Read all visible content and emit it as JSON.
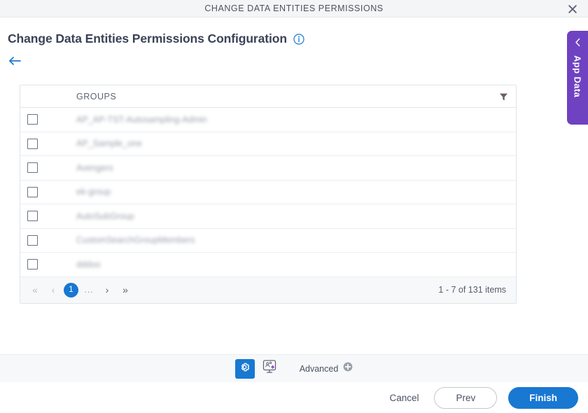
{
  "window": {
    "title": "CHANGE DATA ENTITIES PERMISSIONS",
    "close_icon": "close-icon"
  },
  "page": {
    "title": "Change Data Entities Permissions Configuration",
    "info_icon": "info-icon",
    "back_icon": "back-arrow-icon"
  },
  "grid": {
    "columns": [
      "",
      "GROUPS"
    ],
    "group_column_label": "GROUPS",
    "filter_icon": "filter-icon",
    "rows": [
      {
        "checked": false,
        "group": "AP_AP-TST-Autosampling-Admin"
      },
      {
        "checked": false,
        "group": "AP_Sample_one"
      },
      {
        "checked": false,
        "group": "Avengers"
      },
      {
        "checked": false,
        "group": "ek-group"
      },
      {
        "checked": false,
        "group": "AutoSubGroup"
      },
      {
        "checked": false,
        "group": "CustomSearchGroupMembers"
      },
      {
        "checked": false,
        "group": "dddoo"
      }
    ]
  },
  "pager": {
    "first_label": "«",
    "prev_label": "‹",
    "current_page": "1",
    "dots_label": "...",
    "next_label": "›",
    "last_label": "»",
    "info": "1 - 7 of 131 items"
  },
  "toolbar": {
    "gear_icon": "gear-icon",
    "screen_icon": "add-screen-icon",
    "advanced_label": "Advanced",
    "advanced_add_icon": "plus-circle-icon"
  },
  "footer": {
    "cancel_label": "Cancel",
    "prev_label": "Prev",
    "finish_label": "Finish"
  },
  "app_data_tab": {
    "label": "App Data",
    "chevron_icon": "chevron-left-icon"
  },
  "colors": {
    "accent_blue": "#1878d2",
    "purple_tab": "#6f42c1",
    "header_bg": "#f4f5f7",
    "toolbar_bg": "#f7f8fa",
    "text": "#3c4257"
  }
}
